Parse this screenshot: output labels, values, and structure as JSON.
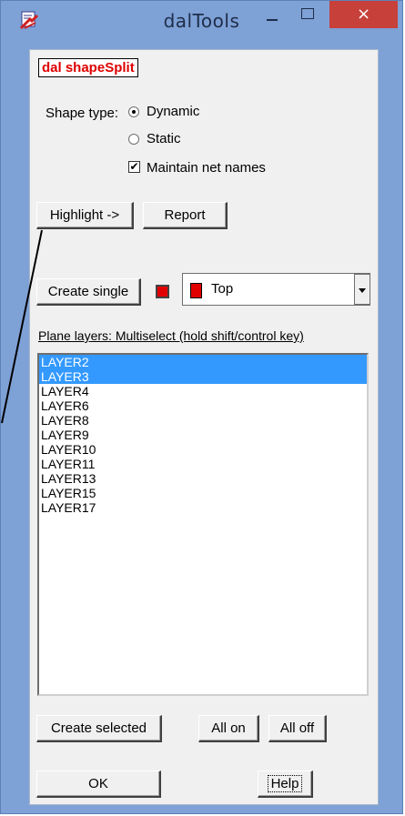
{
  "window": {
    "title": "dalTools",
    "close_glyph": "×",
    "icon": "daltools-app-icon",
    "title_bar_color": "#7ea1d6",
    "close_color": "#c7403a"
  },
  "header_label": "dal shapeSplit",
  "shape_type": {
    "label": "Shape type:",
    "options": [
      {
        "label": "Dynamic",
        "checked": true
      },
      {
        "label": "Static",
        "checked": false
      }
    ]
  },
  "maintain_net_names": {
    "label": "Maintain net names",
    "checked": true,
    "check_glyph": "✔"
  },
  "buttons": {
    "highlight": "Highlight ->",
    "report": "Report",
    "create_single": "Create single",
    "create_selected": "Create selected",
    "all_on": "All on",
    "all_off": "All off",
    "ok": "OK",
    "help": "Help"
  },
  "layer_select": {
    "value": "Top",
    "color": "#e00000"
  },
  "plane_layers": {
    "label": "Plane layers: Multiselect (hold shift/control key)",
    "items": [
      {
        "name": "LAYER2",
        "selected": true
      },
      {
        "name": "LAYER3",
        "selected": true
      },
      {
        "name": "LAYER4",
        "selected": false
      },
      {
        "name": "LAYER6",
        "selected": false
      },
      {
        "name": "LAYER8",
        "selected": false
      },
      {
        "name": "LAYER9",
        "selected": false
      },
      {
        "name": "LAYER10",
        "selected": false
      },
      {
        "name": "LAYER11",
        "selected": false
      },
      {
        "name": "LAYER13",
        "selected": false
      },
      {
        "name": "LAYER15",
        "selected": false
      },
      {
        "name": "LAYER17",
        "selected": false
      }
    ],
    "selection_color": "#3399ff"
  }
}
